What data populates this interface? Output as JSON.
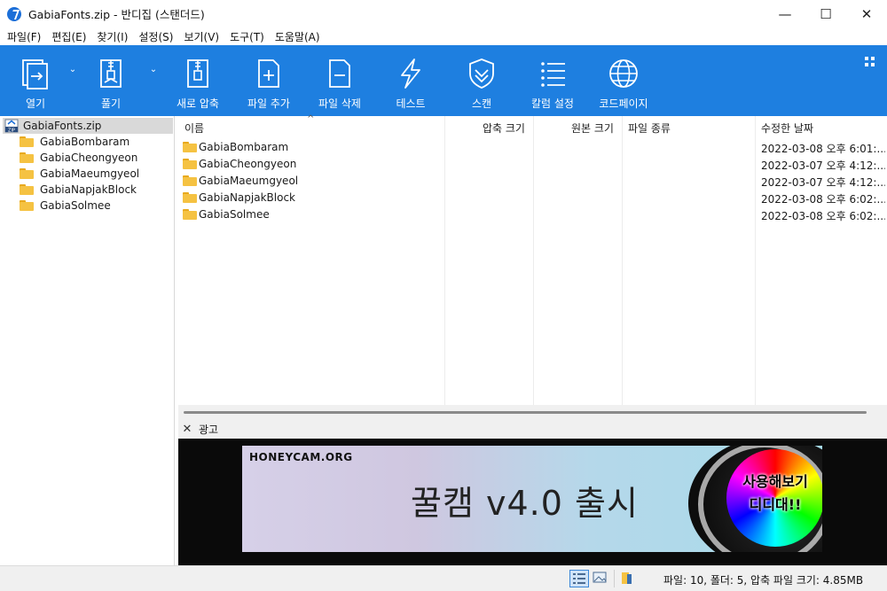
{
  "window": {
    "title": "GabiaFonts.zip - 반디집 (스탠더드)",
    "controls": [
      "—",
      "☐",
      "✕"
    ]
  },
  "menu": [
    "파일(F)",
    "편집(E)",
    "찾기(I)",
    "설정(S)",
    "보기(V)",
    "도구(T)",
    "도움말(A)"
  ],
  "toolbar": {
    "open": "열기",
    "extract": "풀기",
    "new_archive": "새로 압축",
    "add_file": "파일 추가",
    "delete_file": "파일 삭제",
    "test": "테스트",
    "scan": "스캔",
    "column_settings": "칼럼 설정",
    "codepage": "코드페이지"
  },
  "tree": {
    "root": "GabiaFonts.zip",
    "items": [
      "GabiaBombaram",
      "GabiaCheongyeon",
      "GabiaMaeumgyeol",
      "GabiaNapjakBlock",
      "GabiaSolmee"
    ]
  },
  "list": {
    "columns": {
      "name": "이름",
      "compressed": "압축 크기",
      "original": "원본 크기",
      "type": "파일 종류",
      "modified": "수정한 날짜"
    },
    "rows": [
      {
        "name": "GabiaBombaram",
        "modified": "2022-03-08 오후 6:01:..."
      },
      {
        "name": "GabiaCheongyeon",
        "modified": "2022-03-07 오후 4:12:..."
      },
      {
        "name": "GabiaMaeumgyeol",
        "modified": "2022-03-07 오후 4:12:..."
      },
      {
        "name": "GabiaNapjakBlock",
        "modified": "2022-03-08 오후 6:02:..."
      },
      {
        "name": "GabiaSolmee",
        "modified": "2022-03-08 오후 6:02:..."
      }
    ]
  },
  "ad": {
    "close": "✕",
    "label": "광고",
    "site": "HONEYCAM.ORG",
    "headline": "꿀캠 v4.0 출시",
    "cta_line1": "사용해보기",
    "cta_line2": "디디대!!"
  },
  "status": {
    "summary": "파일: 10, 폴더: 5, 압축 파일 크기: 4.85MB"
  },
  "colors": {
    "toolbar": "#1e7fe0",
    "folder": "#f5c242",
    "selection": "#d9d9d9"
  }
}
